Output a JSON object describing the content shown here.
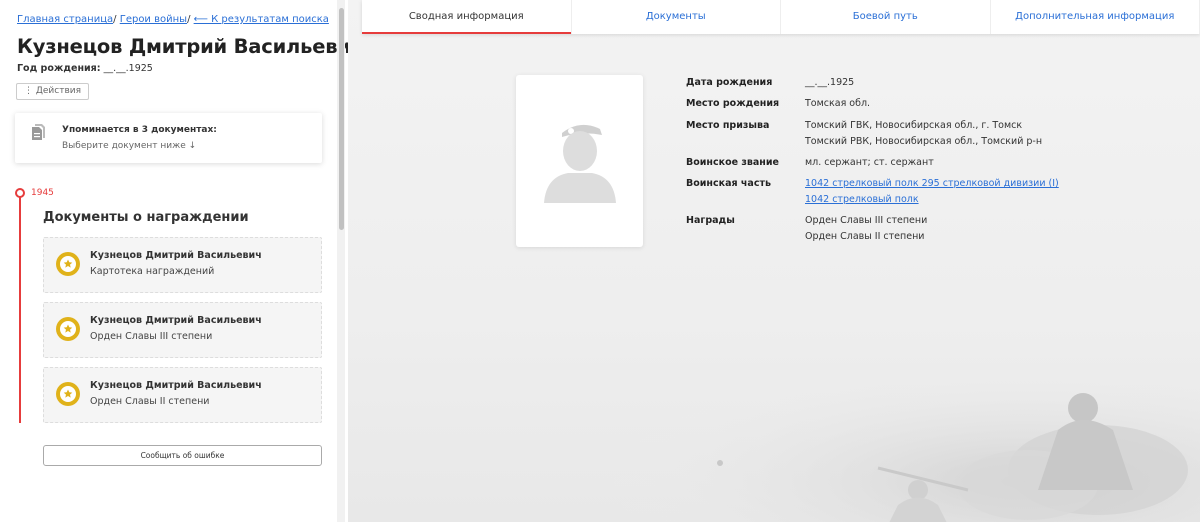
{
  "breadcrumb": {
    "home": "Главная страница",
    "heroes": "Герои войны",
    "back": "⟵ К результатам поиска"
  },
  "hero": {
    "name": "Кузнецов Дмитрий Васильевич",
    "birth_label": "Год рождения:",
    "birth_value": "__.__.1925"
  },
  "actions_label": "⋮ Действия",
  "mentions": {
    "title": "Упоминается в 3 документах:",
    "subtitle": "Выберите документ ниже ↓"
  },
  "timeline": {
    "year": "1945",
    "section_title": "Документы о награждении",
    "awards": [
      {
        "name": "Кузнецов Дмитрий Васильевич",
        "desc": "Картотека награждений"
      },
      {
        "name": "Кузнецов Дмитрий Васильевич",
        "desc": "Орден Славы III степени"
      },
      {
        "name": "Кузнецов Дмитрий Васильевич",
        "desc": "Орден Славы II степени"
      }
    ]
  },
  "report_button": "Сообщить об ошибке",
  "tabs": [
    {
      "label": "Сводная информация",
      "active": true
    },
    {
      "label": "Документы",
      "active": false
    },
    {
      "label": "Боевой путь",
      "active": false
    },
    {
      "label": "Дополнительная информация",
      "active": false
    }
  ],
  "info": {
    "birth_date": {
      "label": "Дата рождения",
      "value": "__.__.1925"
    },
    "birth_place": {
      "label": "Место рождения",
      "value": "Томская обл."
    },
    "draft_place": {
      "label": "Место призыва",
      "values": [
        "Томский ГВК, Новосибирская обл., г. Томск",
        "Томский РВК, Новосибирская обл., Томский р-н"
      ]
    },
    "rank": {
      "label": "Воинское звание",
      "value": "мл. сержант; ст. сержант"
    },
    "unit": {
      "label": "Воинская часть",
      "links": [
        "1042 стрелковый полк 295 стрелковой дивизии (I)",
        "1042 стрелковый полк"
      ]
    },
    "awards": {
      "label": "Награды",
      "values": [
        "Орден Славы III степени",
        "Орден Славы II степени"
      ]
    }
  },
  "colors": {
    "accent": "#e63c3c",
    "link": "#2a6fd6",
    "medal": "#e0b21a"
  }
}
